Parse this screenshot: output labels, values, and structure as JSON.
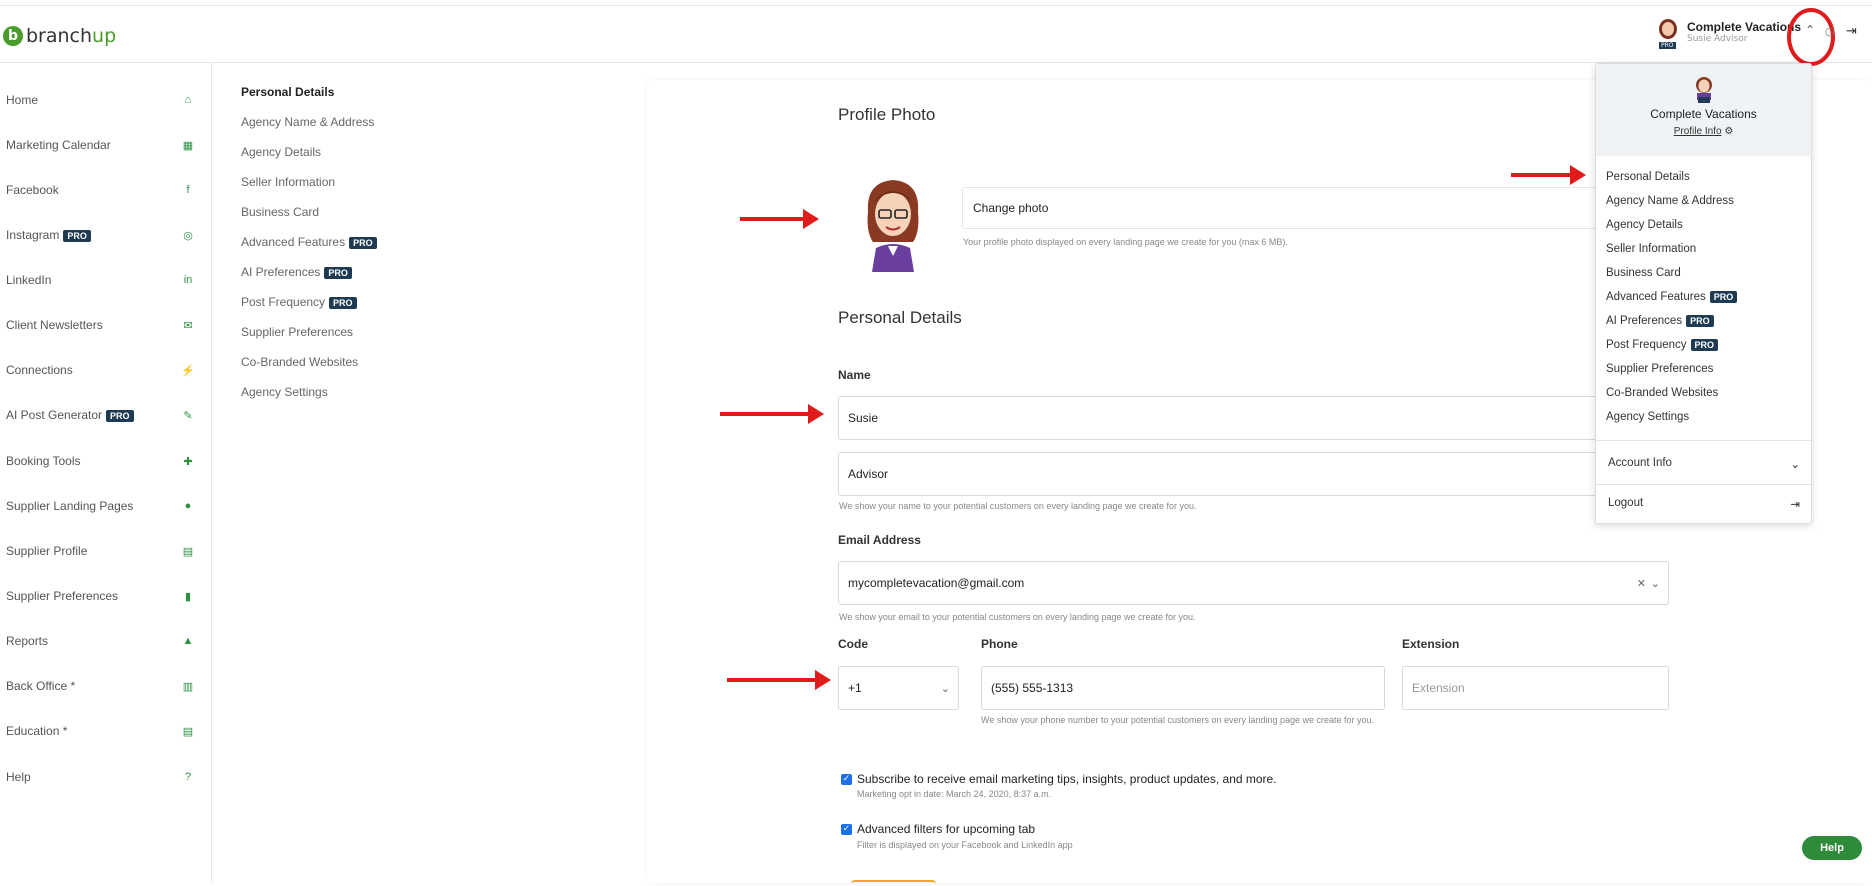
{
  "brand": {
    "logo_b": "b",
    "logo_text_1": "branch",
    "logo_text_2": "up"
  },
  "header": {
    "user_name": "Complete Vacations",
    "user_sub": "Susie Advisor",
    "pro_badge": "PRO"
  },
  "sidebar": {
    "items": [
      {
        "label": "Home",
        "icon": "home-icon",
        "glyph": "⌂"
      },
      {
        "label": "Marketing Calendar",
        "icon": "calendar-icon",
        "glyph": "▦"
      },
      {
        "label": "Facebook",
        "icon": "facebook-icon",
        "glyph": "f"
      },
      {
        "label": "Instagram",
        "icon": "instagram-icon",
        "glyph": "◎",
        "pro": "PRO"
      },
      {
        "label": "LinkedIn",
        "icon": "linkedin-icon",
        "glyph": "in"
      },
      {
        "label": "Client Newsletters",
        "icon": "envelope-icon",
        "glyph": "✉"
      },
      {
        "label": "Connections",
        "icon": "plug-icon",
        "glyph": "⚡"
      },
      {
        "label": "AI Post Generator",
        "icon": "edit-icon",
        "glyph": "✎",
        "pro": "PRO"
      },
      {
        "label": "Booking Tools",
        "icon": "wrench-icon",
        "glyph": "✚"
      },
      {
        "label": "Supplier Landing Pages",
        "icon": "globe-icon",
        "glyph": "●"
      },
      {
        "label": "Supplier Profile",
        "icon": "book-icon",
        "glyph": "▤"
      },
      {
        "label": "Supplier Preferences",
        "icon": "bookmark-icon",
        "glyph": "▮"
      },
      {
        "label": "Reports",
        "icon": "chart-icon",
        "glyph": "▲"
      },
      {
        "label": "Back Office *",
        "icon": "map-icon",
        "glyph": "▥"
      },
      {
        "label": "Education *",
        "icon": "book-open-icon",
        "glyph": "▤"
      },
      {
        "label": "Help",
        "icon": "question-icon",
        "glyph": "?"
      }
    ]
  },
  "subnav": {
    "items": [
      {
        "label": "Personal Details"
      },
      {
        "label": "Agency Name & Address"
      },
      {
        "label": "Agency Details"
      },
      {
        "label": "Seller Information"
      },
      {
        "label": "Business Card"
      },
      {
        "label": "Advanced Features",
        "pro": "PRO"
      },
      {
        "label": "AI Preferences",
        "pro": "PRO"
      },
      {
        "label": "Post Frequency",
        "pro": "PRO"
      },
      {
        "label": "Supplier Preferences"
      },
      {
        "label": "Co-Branded Websites"
      },
      {
        "label": "Agency Settings"
      }
    ]
  },
  "main": {
    "profile_photo_title": "Profile Photo",
    "change_photo": "Change photo",
    "photo_hint": "Your profile photo displayed on every landing page we create for you (max 6 MB).",
    "personal_details_title": "Personal Details",
    "name_label": "Name",
    "first_name": "Susie",
    "last_name": "Advisor",
    "name_hint": "We show your name to your potential customers on every landing page we create for you.",
    "email_label": "Email Address",
    "email_value": "mycompletevacation@gmail.com",
    "email_hint": "We show your email to your potential customers on every landing page we create for you.",
    "code_label": "Code",
    "code_value": "+1",
    "phone_label": "Phone",
    "phone_value": "(555) 555-1313",
    "phone_hint": "We show your phone number to your potential customers on every landing page we create for you.",
    "extension_label": "Extension",
    "extension_placeholder": "Extension",
    "subscribe_label": "Subscribe to receive email marketing tips, insights, product updates, and more.",
    "subscribe_sub": "Marketing opt in date: March 24, 2020, 8:37 a.m.",
    "filters_label": "Advanced filters for upcoming tab",
    "filters_sub": "Filter is displayed on your Facebook and LinkedIn app"
  },
  "dropdown": {
    "name": "Complete Vacations",
    "profile_info": "Profile Info",
    "items": [
      {
        "label": "Personal Details"
      },
      {
        "label": "Agency Name & Address"
      },
      {
        "label": "Agency Details"
      },
      {
        "label": "Seller Information"
      },
      {
        "label": "Business Card"
      },
      {
        "label": "Advanced Features",
        "pro": "PRO"
      },
      {
        "label": "AI Preferences",
        "pro": "PRO"
      },
      {
        "label": "Post Frequency",
        "pro": "PRO"
      },
      {
        "label": "Supplier Preferences"
      },
      {
        "label": "Co-Branded Websites"
      },
      {
        "label": "Agency Settings"
      }
    ],
    "account_info": "Account Info",
    "logout": "Logout"
  },
  "help_button": "Help",
  "colors": {
    "brand_green": "#4a9d2a",
    "pro_badge": "#1f3b54",
    "annotation_red": "#e01b1b"
  }
}
